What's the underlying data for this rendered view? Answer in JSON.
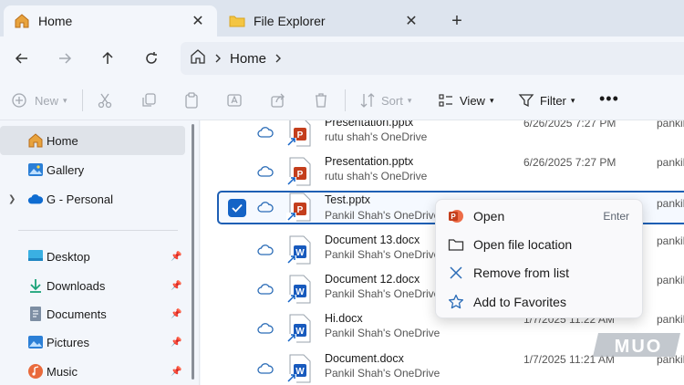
{
  "tabs": [
    {
      "label": "Home",
      "icon": "home-icon",
      "active": true
    },
    {
      "label": "File Explorer",
      "icon": "folder-icon",
      "active": false
    }
  ],
  "address": {
    "segments": [
      "Home"
    ]
  },
  "commands": {
    "new_label": "New",
    "sort_label": "Sort",
    "view_label": "View",
    "filter_label": "Filter"
  },
  "sidebar": {
    "items": [
      {
        "label": "Home",
        "icon": "home-icon"
      },
      {
        "label": "Gallery",
        "icon": "gallery-icon"
      },
      {
        "label": "G - Personal",
        "icon": "onedrive-cloud-icon"
      },
      {
        "label": "Desktop",
        "icon": "desktop-icon"
      },
      {
        "label": "Downloads",
        "icon": "download-icon"
      },
      {
        "label": "Documents",
        "icon": "documents-icon"
      },
      {
        "label": "Pictures",
        "icon": "pictures-icon"
      },
      {
        "label": "Music",
        "icon": "music-icon"
      }
    ]
  },
  "files": [
    {
      "name": "Presentation.pptx",
      "location": "rutu shah's OneDrive",
      "date": "6/26/2025 7:27 PM",
      "owner": "pankil",
      "type": "pptx"
    },
    {
      "name": "Presentation.pptx",
      "location": "rutu shah's OneDrive",
      "date": "6/26/2025 7:27 PM",
      "owner": "pankil",
      "type": "pptx"
    },
    {
      "name": "Test.pptx",
      "location": "Pankil Shah's OneDrive",
      "date": "",
      "owner": "pankil",
      "type": "pptx"
    },
    {
      "name": "Document 13.docx",
      "location": "Pankil Shah's OneDrive",
      "date": "",
      "owner": "pankil",
      "type": "docx"
    },
    {
      "name": "Document 12.docx",
      "location": "Pankil Shah's OneDrive",
      "date": "",
      "owner": "pankil",
      "type": "docx"
    },
    {
      "name": "Hi.docx",
      "location": "Pankil Shah's OneDrive",
      "date": "1/7/2025 11:22 AM",
      "owner": "pankil",
      "type": "docx"
    },
    {
      "name": "Document.docx",
      "location": "Pankil Shah's OneDrive",
      "date": "1/7/2025 11:21 AM",
      "owner": "pankil",
      "type": "docx"
    }
  ],
  "context_menu": {
    "items": [
      {
        "label": "Open",
        "shortcut": "Enter",
        "icon": "powerpoint-icon"
      },
      {
        "label": "Open file location",
        "shortcut": "",
        "icon": "folder-outline-icon"
      },
      {
        "label": "Remove from list",
        "shortcut": "",
        "icon": "close-icon"
      },
      {
        "label": "Add to Favorites",
        "shortcut": "",
        "icon": "star-icon"
      }
    ]
  },
  "watermark": "MUO",
  "colors": {
    "accent": "#1463c6",
    "powerpoint": "#c43e1c",
    "word": "#185abd"
  }
}
